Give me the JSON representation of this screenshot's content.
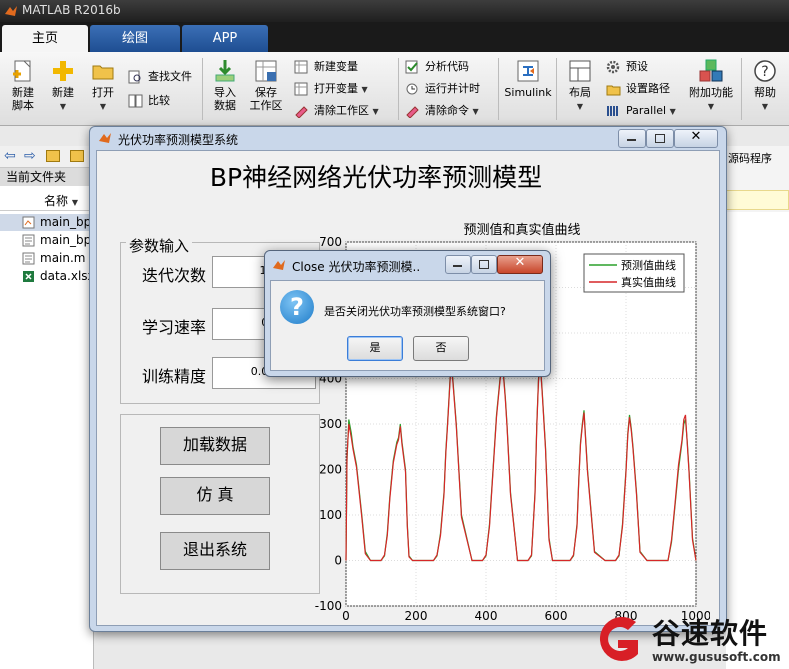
{
  "app": {
    "title": "MATLAB R2016b"
  },
  "tabs": [
    {
      "label": "主页"
    },
    {
      "label": "绘图"
    },
    {
      "label": "APP"
    }
  ],
  "ribbon": {
    "new_script": "新建\n脚本",
    "new": "新建",
    "open": "打开",
    "find_files": "查找文件",
    "compare": "比较",
    "import_data": "导入\n数据",
    "save_workspace": "保存\n工作区",
    "new_variable": "新建变量",
    "open_variable": "打开变量",
    "clear_workspace": "清除工作区",
    "analyze_code": "分析代码",
    "run_and_time": "运行并计时",
    "clear_commands": "清除命令",
    "simulink": "Simulink",
    "layout": "布局",
    "preferences": "预设",
    "set_path": "设置路径",
    "parallel": "Parallel",
    "addons": "附加功能",
    "help": "帮助"
  },
  "files": {
    "panel_title": "当前文件夹",
    "column_name": "名称",
    "items": [
      {
        "name": "main_bp"
      },
      {
        "name": "main_bp"
      },
      {
        "name": "main.m"
      },
      {
        "name": "data.xlsx"
      }
    ]
  },
  "right_panel": {
    "label": "源码程序"
  },
  "gui": {
    "window_title": "光伏功率预测模型系统",
    "main_title": "BP神经网络光伏功率预测模型",
    "params_title": "参数输入",
    "params": [
      {
        "label": "迭代次数",
        "value": "100"
      },
      {
        "label": "学习速率",
        "value": "0.1"
      },
      {
        "label": "训练精度",
        "value": "0.0000"
      }
    ],
    "buttons": {
      "load": "加载数据",
      "simulate": "仿 真",
      "exit": "退出系统"
    }
  },
  "dialog": {
    "title": "Close 光伏功率预测模..",
    "message": "是否关闭光伏功率预测模型系统窗口?",
    "yes": "是",
    "no": "否"
  },
  "watermark": {
    "text": "谷速软件",
    "url": "www.gususoft.com"
  },
  "chart_data": {
    "type": "line",
    "title": "预测值和真实值曲线",
    "xlabel": "",
    "ylabel": "",
    "xlim": [
      0,
      1000
    ],
    "ylim": [
      -100,
      700
    ],
    "xticks": [
      0,
      200,
      400,
      600,
      800,
      1000
    ],
    "yticks": [
      -100,
      0,
      100,
      200,
      300,
      400,
      500,
      600,
      700
    ],
    "grid": true,
    "legend": "top-right",
    "series": [
      {
        "name": "预测值曲线",
        "color": "#2ca02c",
        "x": [
          0,
          3,
          8,
          15,
          20,
          30,
          45,
          55,
          70,
          90,
          100,
          110,
          118,
          125,
          135,
          145,
          150,
          155,
          160,
          170,
          175,
          180,
          190,
          195,
          205,
          230,
          250,
          260,
          270,
          280,
          285,
          290,
          295,
          300,
          305,
          315,
          330,
          360,
          380,
          390,
          400,
          410,
          420,
          430,
          440,
          445,
          450,
          455,
          460,
          470,
          490,
          510,
          520,
          530,
          540,
          545,
          550,
          555,
          560,
          570,
          580,
          590,
          610,
          630,
          640,
          650,
          660,
          665,
          670,
          675,
          680,
          690,
          710,
          740,
          760,
          770,
          780,
          790,
          800,
          805,
          810,
          815,
          820,
          830,
          840,
          860,
          880,
          900,
          920,
          930,
          940,
          950,
          960,
          965,
          970,
          975,
          980,
          990,
          1000
        ],
        "y": [
          0,
          220,
          310,
          280,
          250,
          210,
          100,
          20,
          0,
          0,
          0,
          10,
          60,
          140,
          220,
          260,
          270,
          300,
          260,
          200,
          80,
          10,
          0,
          0,
          0,
          0,
          0,
          10,
          60,
          150,
          240,
          300,
          370,
          440,
          400,
          300,
          100,
          0,
          0,
          0,
          10,
          80,
          200,
          320,
          400,
          420,
          410,
          360,
          300,
          150,
          0,
          0,
          0,
          10,
          150,
          300,
          400,
          430,
          380,
          250,
          50,
          0,
          0,
          0,
          0,
          10,
          80,
          180,
          260,
          300,
          330,
          200,
          20,
          0,
          0,
          0,
          10,
          80,
          200,
          280,
          320,
          290,
          250,
          150,
          20,
          0,
          0,
          0,
          0,
          40,
          120,
          200,
          260,
          300,
          310,
          260,
          200,
          50,
          0
        ]
      },
      {
        "name": "真实值曲线",
        "color": "#d62728",
        "x": [
          0,
          3,
          8,
          15,
          20,
          30,
          45,
          55,
          70,
          90,
          100,
          110,
          118,
          125,
          135,
          145,
          150,
          155,
          160,
          170,
          175,
          180,
          190,
          195,
          205,
          230,
          250,
          260,
          270,
          280,
          285,
          290,
          295,
          300,
          305,
          315,
          330,
          360,
          380,
          390,
          400,
          410,
          420,
          430,
          440,
          445,
          450,
          455,
          460,
          470,
          490,
          510,
          520,
          530,
          540,
          545,
          550,
          555,
          560,
          570,
          580,
          590,
          610,
          630,
          640,
          650,
          660,
          665,
          670,
          675,
          680,
          690,
          710,
          740,
          760,
          770,
          780,
          790,
          800,
          805,
          810,
          815,
          820,
          830,
          840,
          860,
          880,
          900,
          920,
          930,
          940,
          950,
          960,
          965,
          970,
          975,
          980,
          990,
          1000
        ],
        "y": [
          0,
          230,
          300,
          270,
          245,
          205,
          95,
          15,
          0,
          0,
          0,
          12,
          55,
          135,
          215,
          255,
          265,
          295,
          255,
          195,
          75,
          8,
          0,
          0,
          0,
          0,
          0,
          12,
          55,
          145,
          235,
          295,
          365,
          430,
          395,
          295,
          95,
          0,
          0,
          0,
          12,
          75,
          195,
          315,
          395,
          425,
          405,
          355,
          295,
          145,
          0,
          0,
          0,
          12,
          145,
          295,
          395,
          435,
          375,
          245,
          45,
          0,
          0,
          0,
          0,
          12,
          75,
          175,
          255,
          295,
          325,
          195,
          18,
          0,
          0,
          0,
          12,
          75,
          195,
          275,
          315,
          285,
          245,
          145,
          18,
          0,
          0,
          0,
          0,
          45,
          125,
          210,
          265,
          310,
          320,
          255,
          195,
          45,
          0
        ]
      }
    ]
  }
}
